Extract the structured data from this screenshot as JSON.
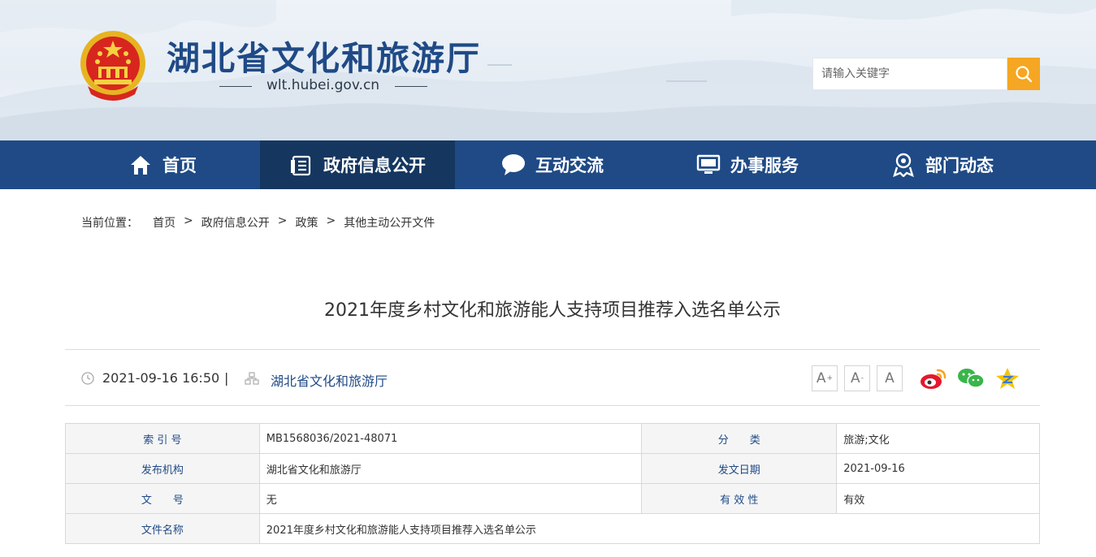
{
  "header": {
    "site_title": "湖北省文化和旅游厅",
    "site_url": "wlt.hubei.gov.cn",
    "emblem_icon": "national-emblem-icon",
    "search_placeholder": "请输入关键字",
    "search_icon": "search-icon",
    "accent_color": "#f5a623"
  },
  "nav": {
    "bg_color": "#1f4a86",
    "items": [
      {
        "label": "首页",
        "icon": "home-icon",
        "active": false
      },
      {
        "label": "政府信息公开",
        "icon": "document-list-icon",
        "active": true
      },
      {
        "label": "互动交流",
        "icon": "chat-bubble-icon",
        "active": false
      },
      {
        "label": "办事服务",
        "icon": "monitor-icon",
        "active": false
      },
      {
        "label": "部门动态",
        "icon": "person-badge-icon",
        "active": false
      }
    ]
  },
  "breadcrumb": {
    "label": "当前位置：",
    "items": [
      "首页",
      "政府信息公开",
      "政策",
      "其他主动公开文件"
    ],
    "separator": ">"
  },
  "article": {
    "title": "2021年度乡村文化和旅游能人支持项目推荐入选名单公示",
    "datetime": "2021-09-16 16:50",
    "divider": "|",
    "publisher": "湖北省文化和旅游厅"
  },
  "font_controls": {
    "larger": "A",
    "larger_mark": "+",
    "smaller": "A",
    "smaller_mark": "-",
    "default": "A"
  },
  "share": [
    "weibo-icon",
    "wechat-icon",
    "qzone-icon"
  ],
  "info": {
    "index_label": "索 引 号",
    "index_value": "MB1568036/2021-48071",
    "category_label": "分　　类",
    "category_value": "旅游;文化",
    "issuer_label": "发布机构",
    "issuer_value": "湖北省文化和旅游厅",
    "issue_date_label": "发文日期",
    "issue_date_value": "2021-09-16",
    "doc_no_label": "文　　号",
    "doc_no_value": "无",
    "validity_label": "有 效 性",
    "validity_value": "有效",
    "doc_name_label": "文件名称",
    "doc_name_value": "2021年度乡村文化和旅游能人支持项目推荐入选名单公示"
  }
}
